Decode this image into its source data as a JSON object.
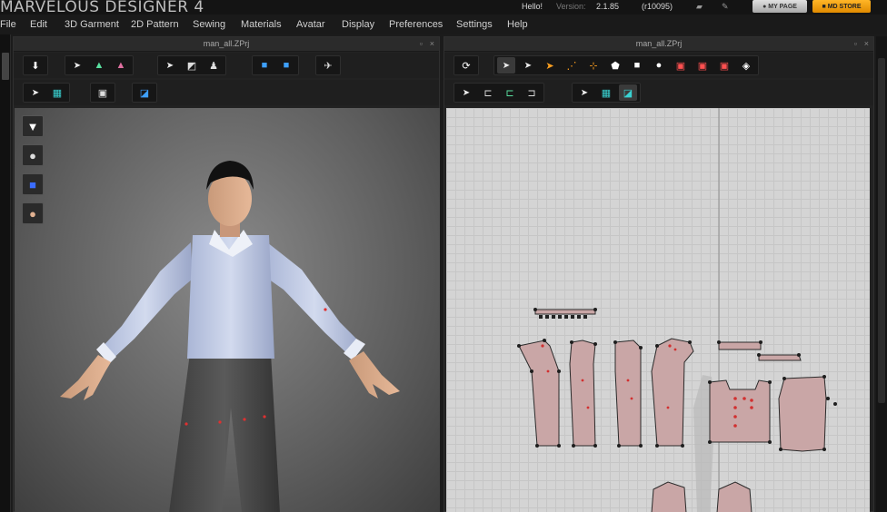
{
  "app": {
    "title": "MARVELOUS DESIGNER 4",
    "greeting": "Hello!",
    "version_label": "Version:",
    "version": "2.1.85",
    "build": "(r10095)",
    "my_page_label": "MY PAGE",
    "md_store_label": "MD STORE",
    "colors": {
      "accent_orange": "#f5a000",
      "background": "#1b1b1b"
    }
  },
  "menu": {
    "items": [
      "File",
      "Edit",
      "3D Garment",
      "2D Pattern",
      "Sewing",
      "Materials",
      "Avatar",
      "Display",
      "Preferences",
      "Settings",
      "Help"
    ]
  },
  "panels": {
    "left": {
      "title": "man_all.ZPrj",
      "toolbar_rows": [
        [
          "move-down-icon",
          "select-move-icon",
          "garment-green-icon",
          "garment-pink-icon",
          "select-pin-icon",
          "fold-icon",
          "avatar-pose-icon",
          "shirt-blue-icon",
          "shirt-blue2-icon",
          "running-icon"
        ],
        [
          "select-mesh-icon",
          "mesh-grid-icon",
          "avatar-box-icon",
          "flag-icon"
        ]
      ],
      "side_icons": [
        "shirt-white-icon",
        "avatar-bust-icon",
        "garment-blue-icon",
        "avatar-head-icon"
      ]
    },
    "right": {
      "title": "man_all.ZPrj",
      "toolbar_rows": [
        [
          "rotate-icon",
          "select-pattern-icon",
          "edit-point-icon",
          "curve-point-icon",
          "add-point-icon",
          "center-point-icon",
          "polygon-icon",
          "rectangle-icon",
          "circle-icon",
          "dart-icon",
          "internal-rect-icon",
          "internal-circle-icon",
          "trace-icon"
        ],
        [
          "select-sewing-icon",
          "segment-sew-icon",
          "free-sew-icon",
          "sew-check-icon",
          "select-texture-icon",
          "texture-grid-icon",
          "texture-edit-icon"
        ]
      ]
    }
  }
}
